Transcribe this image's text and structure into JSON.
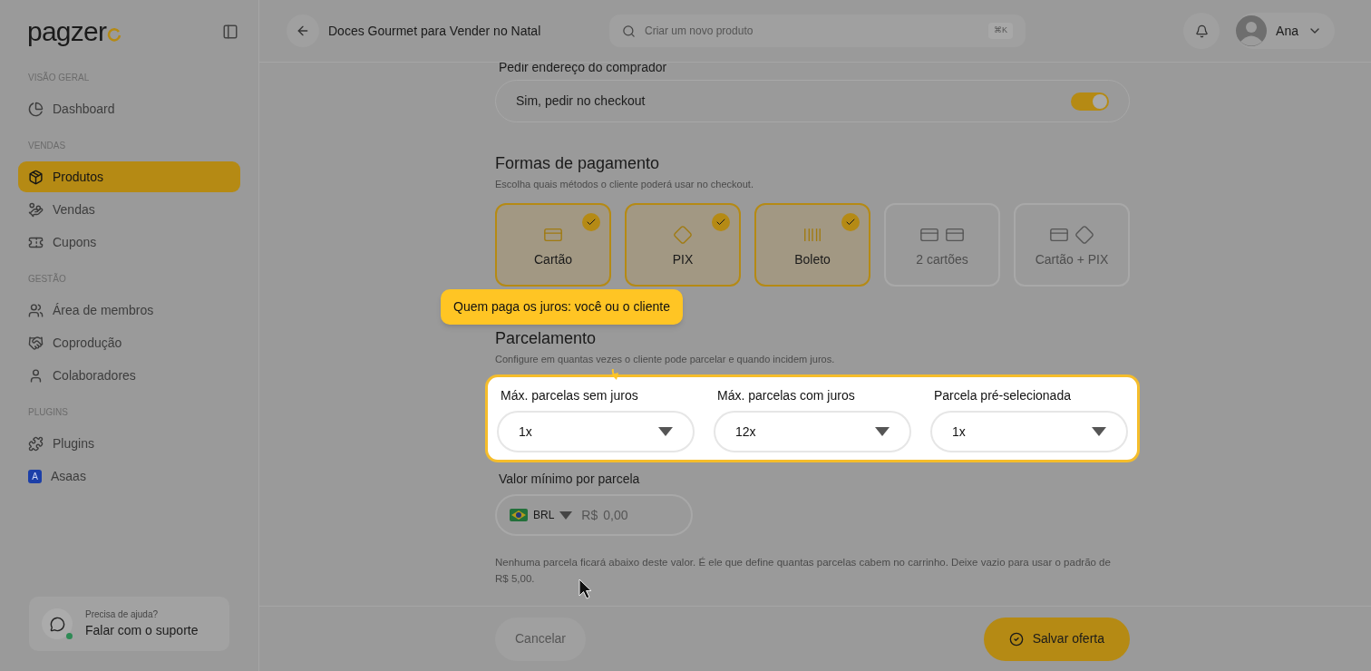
{
  "sidebar": {
    "logo": "pagzer",
    "sections": [
      {
        "title": "VISÃO GERAL",
        "items": [
          {
            "label": "Dashboard",
            "kind": "chart",
            "selected": false
          }
        ]
      },
      {
        "title": "VENDAS",
        "items": [
          {
            "label": "Produtos",
            "kind": "boxes",
            "selected": true
          },
          {
            "label": "Vendas",
            "kind": "hand",
            "selected": false
          },
          {
            "label": "Cupons",
            "kind": "pill",
            "selected": false
          }
        ]
      },
      {
        "title": "GESTÃO",
        "items": [
          {
            "label": "Área de membros",
            "kind": "users",
            "selected": false
          },
          {
            "label": "Coprodução",
            "kind": "handshake",
            "selected": false
          },
          {
            "label": "Colaboradores",
            "kind": "user",
            "selected": false
          }
        ]
      },
      {
        "title": "PLUGINS",
        "items": [
          {
            "label": "Plugins",
            "kind": "puzzle",
            "selected": false
          },
          {
            "label": "Asaas",
            "kind": "letter",
            "badge": "A",
            "selected": false
          }
        ]
      }
    ],
    "support": {
      "hint": "Precisa de ajuda?",
      "label": "Falar com o suporte",
      "online": true
    }
  },
  "header": {
    "title": "Doces Gourmet para Vender no Natal",
    "search": {
      "placeholder": "Criar um novo produto",
      "shortcut": "⌘K"
    },
    "user": "Ana"
  },
  "address": {
    "label": "Pedir endereço do comprador",
    "value": "Sim, pedir no checkout",
    "on": true
  },
  "payment": {
    "title": "Formas de pagamento",
    "subtitle": "Escolha quais métodos o cliente poderá usar no checkout.",
    "methods": [
      {
        "label": "Cartão",
        "kind": "card",
        "selected": true
      },
      {
        "label": "PIX",
        "kind": "pix",
        "selected": true
      },
      {
        "label": "Boleto",
        "kind": "boleto",
        "selected": true
      },
      {
        "label": "2 cartões",
        "kind": "two_cards",
        "selected": false
      },
      {
        "label": "Cartão + PIX",
        "kind": "card_pix",
        "selected": false
      }
    ]
  },
  "installments": {
    "title": "Parcelamento",
    "subtitle": "Configure em quantas vezes o cliente pode parcelar e quando incidem juros.",
    "selects": [
      {
        "label": "Máx. parcelas sem juros",
        "value": "1x"
      },
      {
        "label": "Máx. parcelas com juros",
        "value": "12x"
      },
      {
        "label": "Parcela pré-selecionada",
        "value": "1x"
      }
    ],
    "min_value": {
      "label": "Valor mínimo por parcela",
      "currency": "BRL",
      "prefix": "R$",
      "placeholder": "0,00"
    },
    "help": "Nenhuma parcela ficará abaixo deste valor. É ele que define quantas parcelas cabem no carrinho. Deixe vazio para usar o padrão de R$ 5,00."
  },
  "tooltip": "Quem paga os juros: você ou o cliente",
  "footer": {
    "cancel": "Cancelar",
    "save": "Salvar oferta"
  }
}
